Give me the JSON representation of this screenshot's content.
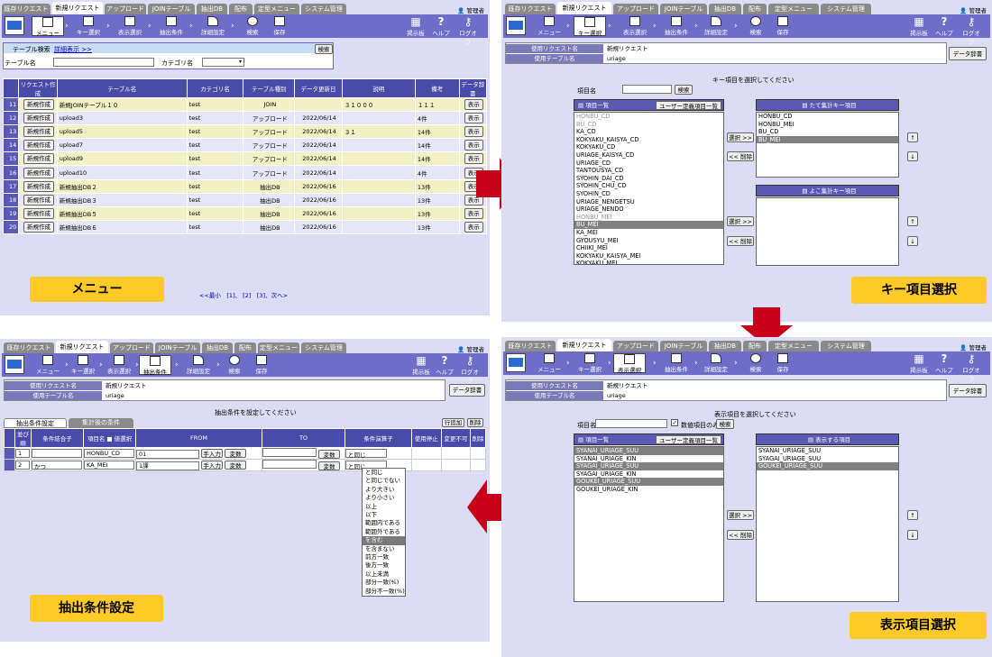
{
  "tabs": [
    "既存リクエスト",
    "新規リクエスト",
    "アップロード",
    "JOINテーブル",
    "抽出DB",
    "配布",
    "定型メニュー",
    "システム管理"
  ],
  "admin": "管理者",
  "toolbar": {
    "menu": "メニュー",
    "key": "キー選択",
    "disp": "表示選択",
    "cond": "抽出条件",
    "detail": "詳細設定",
    "search": "検索",
    "save": "保存",
    "board": "掲示板",
    "help": "ヘルプ",
    "logout": "ログオフ"
  },
  "p1": {
    "search_title": "テーブル検索",
    "search_link": "詳細表示 >>",
    "search_btn": "検索",
    "table_label": "テーブル名",
    "category_label": "カテゴリ名",
    "headers": [
      "",
      "リクエスト作成",
      "テーブル名",
      "カテゴリ名",
      "テーブル種別",
      "データ更新日",
      "説明",
      "備考",
      "データ辞書"
    ],
    "rows": [
      [
        "11",
        "新規作成",
        "新規JOINテーブル１０",
        "test",
        "JOIN",
        "",
        "３１０００",
        "１１１",
        "表示"
      ],
      [
        "12",
        "新規作成",
        "upload3",
        "test",
        "アップロード",
        "2022/06/14",
        "",
        "4件",
        "表示"
      ],
      [
        "13",
        "新規作成",
        "upload5",
        "test",
        "アップロード",
        "2022/06/14",
        "３１",
        "14件",
        "表示"
      ],
      [
        "14",
        "新規作成",
        "upload7",
        "test",
        "アップロード",
        "2022/06/14",
        "",
        "14件",
        "表示"
      ],
      [
        "15",
        "新規作成",
        "upload9",
        "test",
        "アップロード",
        "2022/06/14",
        "",
        "14件",
        "表示"
      ],
      [
        "16",
        "新規作成",
        "upload10",
        "test",
        "アップロード",
        "2022/06/14",
        "",
        "4件",
        "表示"
      ],
      [
        "17",
        "新規作成",
        "新規抽出DB２",
        "test",
        "抽出DB",
        "2022/06/16",
        "",
        "13件",
        "表示"
      ],
      [
        "18",
        "新規作成",
        "新規抽出DB３",
        "test",
        "抽出DB",
        "2022/06/16",
        "",
        "13件",
        "表示"
      ],
      [
        "19",
        "新規作成",
        "新規抽出DB５",
        "test",
        "抽出DB",
        "2022/06/16",
        "",
        "13件",
        "表示"
      ],
      [
        "20",
        "新規作成",
        "新規抽出DB６",
        "test",
        "抽出DB",
        "2022/06/16",
        "",
        "13件",
        "表示"
      ]
    ],
    "pager": "<<最小　[1]、 [2]　[3]、次へ>",
    "caption": "メニュー"
  },
  "req": {
    "label1": "使用リクエスト名",
    "val1": "新規リクエスト",
    "label2": "使用テーブル名",
    "val2": "uriage",
    "dict": "データ辞書"
  },
  "p2": {
    "prompt": "キー項目を選択してください",
    "item_label": "項目名",
    "search": "検索",
    "list_head": "項目一覧",
    "user_btn": "ユーザー定義項目一覧",
    "items": [
      "HONBU_CD",
      "BU_CD",
      "KA_CD",
      "KOKYAKU_KAISYA_CD",
      "KOKYAKU_CD",
      "URIAGE_KAISYA_CD",
      "URIAGE_CD",
      "TANTOUSYA_CD",
      "SYOHIN_DAI_CD",
      "SYOHIN_CHU_CD",
      "SYOHIN_CD",
      "URIAGE_NENGETSU",
      "URIAGE_NENDO",
      "HONBU_MEI",
      "BU_MEI",
      "KA_MEI",
      "GYOUSYU_MEI",
      "CHIIKI_MEI",
      "KOKYAKU_KAISYA_MEI",
      "KOKYAKU_MEI"
    ],
    "vhead": "たて集計キー項目",
    "vitems": [
      "HONBU_CD",
      "HONBU_MEI",
      "BU_CD",
      "BU_MEI"
    ],
    "hhead": "よこ集計キー項目",
    "select": "選択 >>",
    "remove": "<< 削除",
    "up": "↑",
    "down": "↓",
    "caption": "キー項目選択"
  },
  "p3": {
    "prompt": "抽出条件を設定してください",
    "tab1": "抽出条件設定",
    "tab2": "集計後の条件",
    "add": "行追加",
    "del": "削除",
    "headers": [
      "",
      "並び順",
      "条件結合子",
      "項目名 ■ 値選択",
      "FROM",
      "TO",
      "条件演算子",
      "使用停止",
      "変更不可",
      "削除"
    ],
    "row1": {
      "order": "1",
      "item": "HONBU_CD",
      "from": "01",
      "op": "と同じ"
    },
    "row2": {
      "order": "2",
      "conj": "かつ",
      "item": "KA_MEI",
      "from": "1課",
      "op": "と同じ"
    },
    "hand": "手入力",
    "var": "変数",
    "ops": [
      "と同じ",
      "と同じでない",
      "より大きい",
      "より小さい",
      "以上",
      "以下",
      "範囲内である",
      "範囲外である",
      "を含む",
      "を含まない",
      "前方一致",
      "後方一致",
      "以上未満",
      "部分一致(%)",
      "部分不一致(%)"
    ],
    "caption": "抽出条件設定"
  },
  "p4": {
    "prompt": "表示項目を選択してください",
    "item_label": "項目名",
    "numeric_only": "数値項目のみ",
    "search": "検索",
    "list_head": "項目一覧",
    "user_btn": "ユーザー定義項目一覧",
    "items": [
      "SYANAI_URIAGE_SUU",
      "SYANAI_URIAGE_KIN",
      "SYAGAI_URIAGE_SUU",
      "SYAGAI_URIAGE_KIN",
      "GOUKEI_URIAGE_SUU",
      "GOUKEI_URIAGE_KIN"
    ],
    "shead": "表示する項目",
    "sitems": [
      "SYANAI_URIAGE_SUU",
      "SYAGAI_URIAGE_SUU",
      "GOUKEI_URIAGE_SUU"
    ],
    "select": "選択 >>",
    "remove": "<< 削除",
    "up": "↑",
    "down": "↓",
    "caption": "表示項目選択"
  },
  "colors": {
    "toolbar": "#6e6ec8",
    "header": "#4a4aa8",
    "caption": "#ffc928",
    "arrow": "#c8001a"
  }
}
